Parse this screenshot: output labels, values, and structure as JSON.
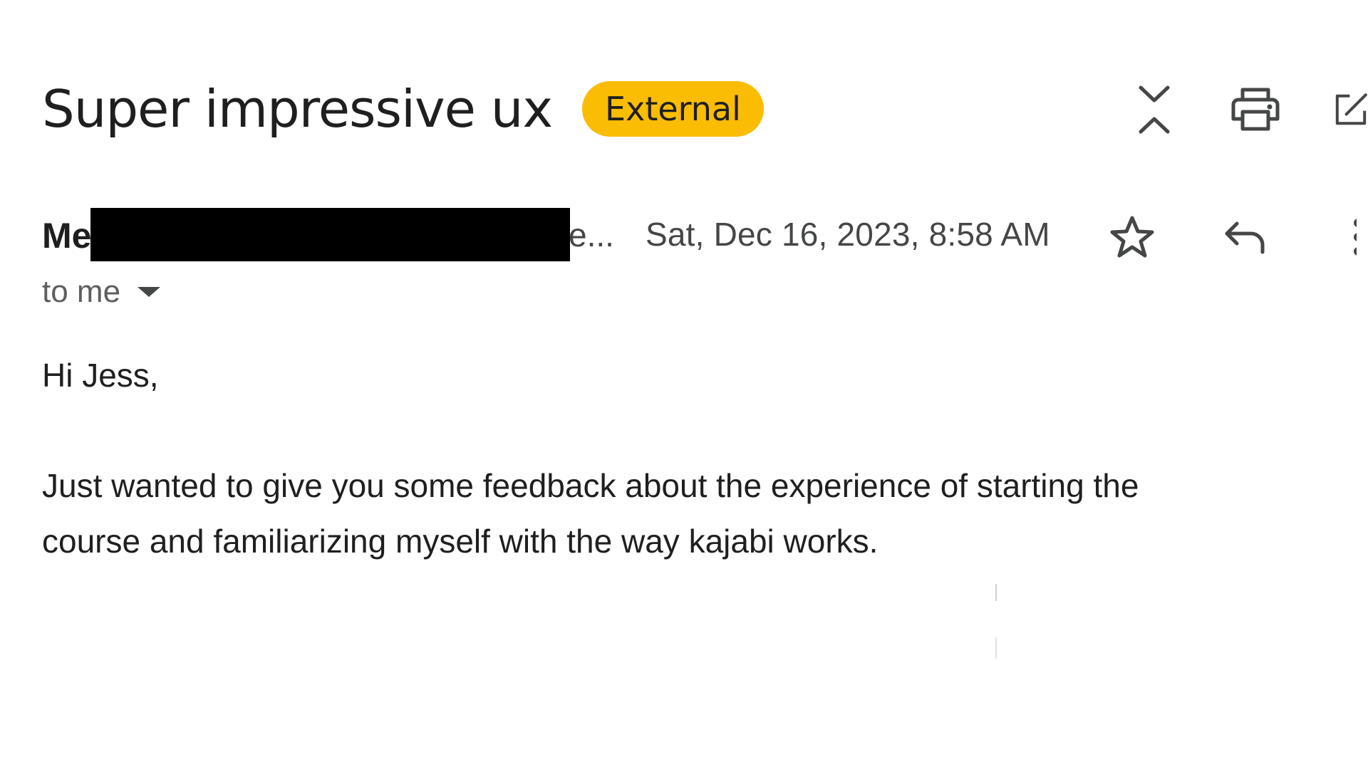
{
  "email": {
    "subject": "Super impressive ux",
    "badge": "External",
    "sender": {
      "name_visible": "Me",
      "email_tail": "e...",
      "redacted": true
    },
    "date": "Sat, Dec 16, 2023, 8:58 AM",
    "recipients_label": "to me",
    "body": {
      "greeting": "Hi Jess,",
      "paragraph_1_line_1": "Just wanted to give you some feedback about the experience of starting the",
      "paragraph_1_line_2": "course and familiarizing myself with the way kajabi works."
    }
  },
  "icons": {
    "collapse": "collapse-all-icon",
    "print": "print-icon",
    "open_new_window": "open-in-new-window-icon",
    "star": "star-icon",
    "reply": "reply-icon",
    "more": "more-vert-icon",
    "recipients_caret": "arrow-drop-down-icon"
  },
  "colors": {
    "badge_background": "#fbbc04",
    "text_primary": "#1f1f1f",
    "text_secondary": "#444746",
    "redaction": "#000000"
  }
}
